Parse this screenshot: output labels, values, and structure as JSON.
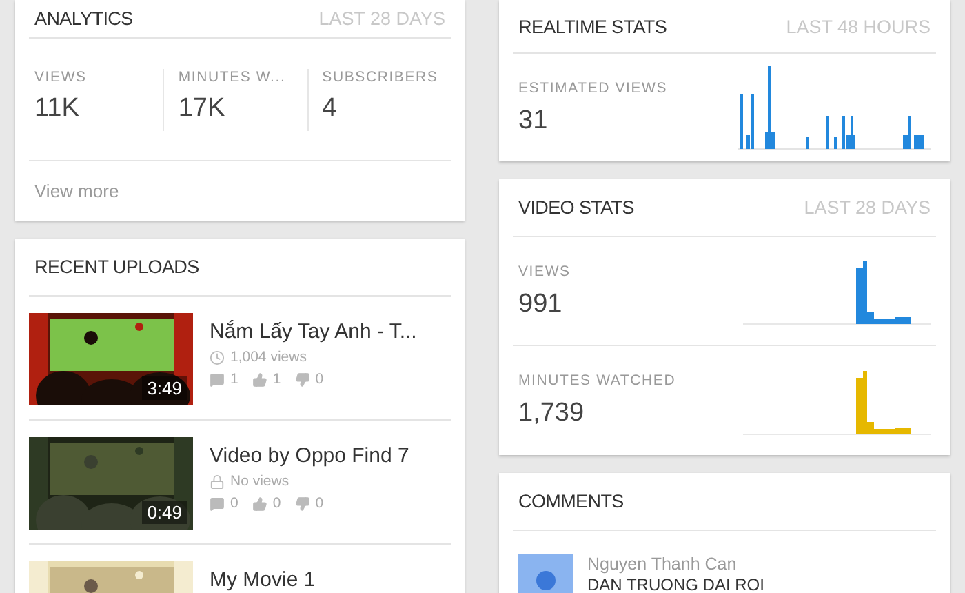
{
  "analytics": {
    "title": "ANALYTICS",
    "period": "LAST 28 DAYS",
    "stats": [
      {
        "label": "VIEWS",
        "value": "11K"
      },
      {
        "label": "MINUTES W...",
        "value": "17K"
      },
      {
        "label": "SUBSCRIBERS",
        "value": "4"
      }
    ],
    "link": "View more"
  },
  "recent_uploads": {
    "title": "RECENT UPLOADS",
    "videos": [
      {
        "title": "Nắm Lấy Tay Anh - T...",
        "duration": "3:49",
        "kind": "public",
        "views": "1,004 views",
        "comments": "1",
        "likes": "1",
        "dislikes": "0"
      },
      {
        "title": "Video by Oppo Find 7",
        "duration": "0:49",
        "kind": "private",
        "views": "No views",
        "comments": "0",
        "likes": "0",
        "dislikes": "0"
      },
      {
        "title": "My Movie 1"
      }
    ]
  },
  "realtime": {
    "title": "REALTIME STATS",
    "period": "LAST 48 HOURS",
    "label": "ESTIMATED VIEWS",
    "value": "31"
  },
  "video_stats": {
    "title": "VIDEO STATS",
    "period": "LAST 28 DAYS",
    "metrics": [
      {
        "label": "VIEWS",
        "value": "991",
        "color": "#2288dd"
      },
      {
        "label": "MINUTES WATCHED",
        "value": "1,739",
        "color": "#e6b800"
      }
    ]
  },
  "comments": {
    "title": "COMMENTS",
    "items": [
      {
        "author": "Nguyen Thanh Can",
        "text": "DAN TRUONG DAI ROI"
      }
    ]
  }
}
